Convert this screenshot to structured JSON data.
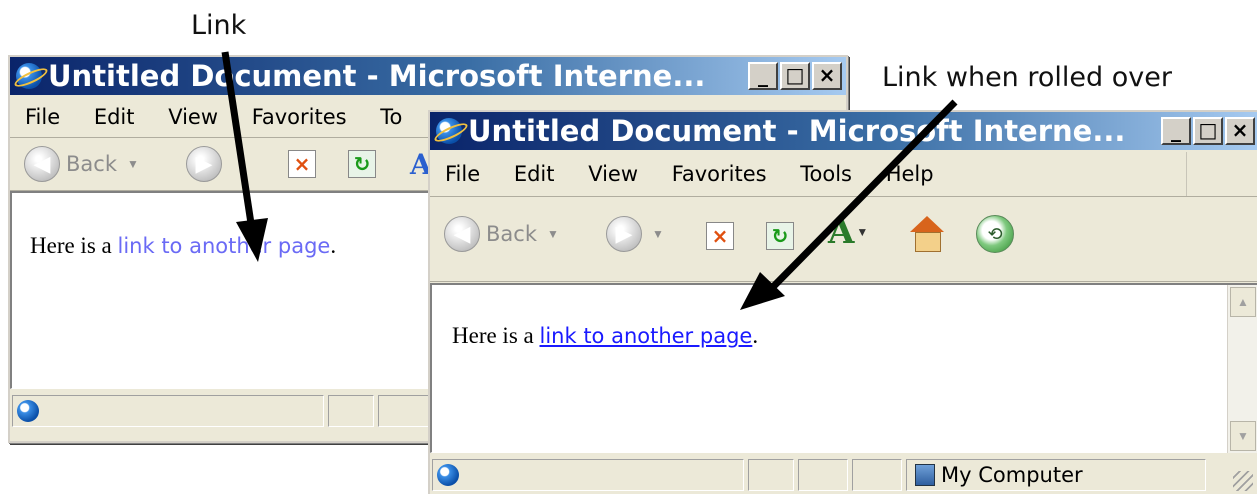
{
  "annotations": {
    "link_label": "Link",
    "rollover_label": "Link when rolled over"
  },
  "window_back": {
    "title": "Untitled Document - Microsoft Interne...",
    "menu": [
      "File",
      "Edit",
      "View",
      "Favorites",
      "To"
    ],
    "toolbar": {
      "back_label": "Back"
    },
    "body_prefix": "Here is a ",
    "link_text": "link to another page",
    "body_suffix": ".",
    "link_state": "normal"
  },
  "window_front": {
    "title": "Untitled Document - Microsoft Interne...",
    "menu": [
      "File",
      "Edit",
      "View",
      "Favorites",
      "Tools",
      "Help"
    ],
    "toolbar": {
      "back_label": "Back"
    },
    "body_prefix": "Here is a ",
    "link_text": "link to another page",
    "body_suffix": ".",
    "link_state": "hover",
    "status_zone": "My Computer"
  },
  "window_buttons": {
    "minimize": "_",
    "maximize": "□",
    "close": "×"
  },
  "colors": {
    "titlebar_start": "#0a246a",
    "titlebar_end": "#a6caf0",
    "link_normal": "#6a6af5",
    "link_hover": "#1a1aff"
  },
  "icons": [
    "ie-logo-icon",
    "back-icon",
    "forward-icon",
    "stop-icon",
    "refresh-icon",
    "text-size-icon",
    "home-icon",
    "history-icon",
    "windows-logo-icon",
    "computer-icon"
  ]
}
